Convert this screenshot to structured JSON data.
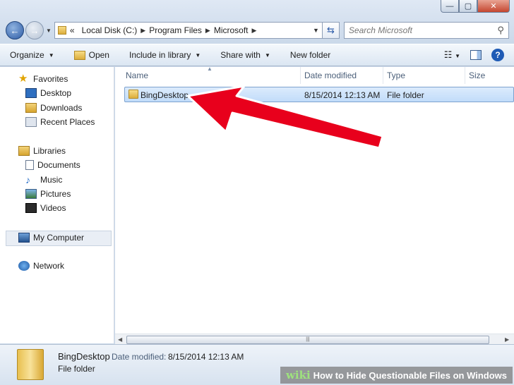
{
  "window": {
    "caption": {
      "minimize": "—",
      "maximize": "▢",
      "close": "✕"
    }
  },
  "address_bar": {
    "overflow": "«",
    "crumbs": [
      "Local Disk (C:)",
      "Program Files",
      "Microsoft"
    ],
    "search_placeholder": "Search Microsoft"
  },
  "toolbar": {
    "organize": "Organize",
    "open": "Open",
    "include": "Include in library",
    "share": "Share with",
    "new_folder": "New folder",
    "help": "?"
  },
  "nav": {
    "favorites": "Favorites",
    "desktop": "Desktop",
    "downloads": "Downloads",
    "recent": "Recent Places",
    "libraries": "Libraries",
    "documents": "Documents",
    "music": "Music",
    "pictures": "Pictures",
    "videos": "Videos",
    "computer": "My Computer",
    "network": "Network"
  },
  "columns": {
    "name": "Name",
    "date": "Date modified",
    "type": "Type",
    "size": "Size"
  },
  "files": [
    {
      "name": "BingDesktop",
      "date": "8/15/2014 12:13 AM",
      "type": "File folder"
    }
  ],
  "details": {
    "name": "BingDesktop",
    "date_label": "Date modified:",
    "date_value": "8/15/2014 12:13 AM",
    "type": "File folder"
  },
  "watermark": {
    "brand": "wiki",
    "title": "How to Hide Questionable Files on Windows"
  },
  "colors": {
    "arrow": "#e8001c",
    "selection": "#c1dcfa"
  },
  "icons": [
    "back-arrow-icon",
    "forward-arrow-icon",
    "folder-icon",
    "refresh-icon",
    "search-icon",
    "star-icon",
    "desktop-icon",
    "downloads-icon",
    "recent-places-icon",
    "libraries-icon",
    "documents-icon",
    "music-icon",
    "pictures-icon",
    "videos-icon",
    "computer-icon",
    "network-icon",
    "view-icon",
    "preview-pane-icon",
    "help-icon"
  ]
}
